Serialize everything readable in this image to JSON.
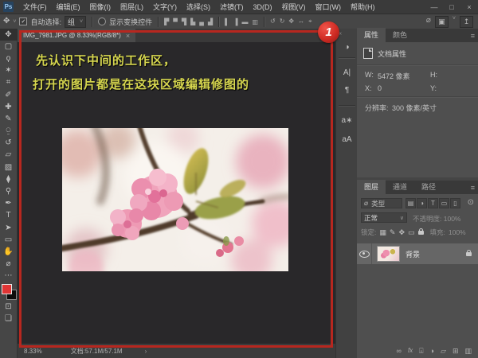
{
  "app": {
    "logo": "Ps"
  },
  "menu_bar": {
    "items": [
      "文件(F)",
      "编辑(E)",
      "图像(I)",
      "图层(L)",
      "文字(Y)",
      "选择(S)",
      "滤镜(T)",
      "3D(D)",
      "视图(V)",
      "窗口(W)",
      "帮助(H)"
    ]
  },
  "window_controls": {
    "minimize": "—",
    "maximize": "□",
    "close": "×"
  },
  "options_bar": {
    "move_icon": "✥",
    "caret": "˅",
    "check_mark": "✓",
    "auto_select_label": "自动选择:",
    "auto_select_value": "组",
    "show_transform_label": "显示变换控件",
    "align_icons": [
      "▛",
      "▀",
      "▜",
      "▙",
      "▄",
      "▟"
    ],
    "dist_icons": [
      "▌",
      "▐",
      "▬",
      "▥"
    ],
    "mode3d_icons": [
      "↺",
      "↻",
      "✥",
      "↔",
      "⌖"
    ],
    "zoom_icon": "⌀",
    "layout_icon": "▣",
    "share_icon": "↥"
  },
  "document_tab": {
    "title": "IMG_7981.JPG @ 8.33%(RGB/8*)",
    "close_icon": "×"
  },
  "annotation": {
    "line1": "先认识下中间的工作区，",
    "line2": "打开的图片都是在这块区域编辑修图的",
    "badge": "1",
    "accent_red": "#b7271f",
    "text_yellow": "#d6d64f"
  },
  "toolbar": {
    "glyphs": [
      "✥",
      "▢",
      "ϙ",
      "✶",
      "⌗",
      "✐",
      "✚",
      "✎",
      "⍜",
      "↺",
      "▱",
      "▨",
      "⧫",
      "⚲",
      "✒",
      "T",
      "➤",
      "▭",
      "✋",
      "⌀",
      "⋯",
      "⊡",
      "❏"
    ]
  },
  "dock": {
    "collapse_icon": "«",
    "adjustments_icon": "◑",
    "character_icon": "A|",
    "paragraph_icon": "¶",
    "glyphs_icon": "a∗",
    "char_styles_icon": "aA"
  },
  "properties_panel": {
    "tab_properties": "属性",
    "tab_color": "颜色",
    "menu_icon": "≡",
    "doc_props_label": "文档属性",
    "w_label": "W:",
    "w_value": "5472 像素",
    "h_label": "H:",
    "x_label": "X:",
    "x_value": "0",
    "y_label": "Y:",
    "res_label": "分辨率:",
    "res_value": "300 像素/英寸"
  },
  "layers_panel": {
    "tab_layers": "图层",
    "tab_channels": "通道",
    "tab_paths": "路径",
    "menu_icon": "≡",
    "search_icon": "⌀",
    "filter_value": "类型",
    "filter_icons": [
      "▤",
      "◑",
      "T",
      "▭",
      "▯"
    ],
    "filter_toggle": "⊙",
    "blend_mode": "正常",
    "blend_caret": "∨",
    "opacity_label": "不透明度:",
    "opacity_value": "100%",
    "lock_label": "锁定:",
    "lock_icons": [
      "▦",
      "✎",
      "✥",
      "▭"
    ],
    "fill_label": "填充:",
    "fill_value": "100%",
    "layer_name": "背景",
    "bottom_icons": [
      "∞",
      "fx",
      "⌻",
      "◑",
      "▱",
      "⊞",
      "▥"
    ]
  },
  "status_bar": {
    "zoom": "8.33%",
    "doc_info": "文档:57.1M/57.1M",
    "chevron": "›"
  }
}
